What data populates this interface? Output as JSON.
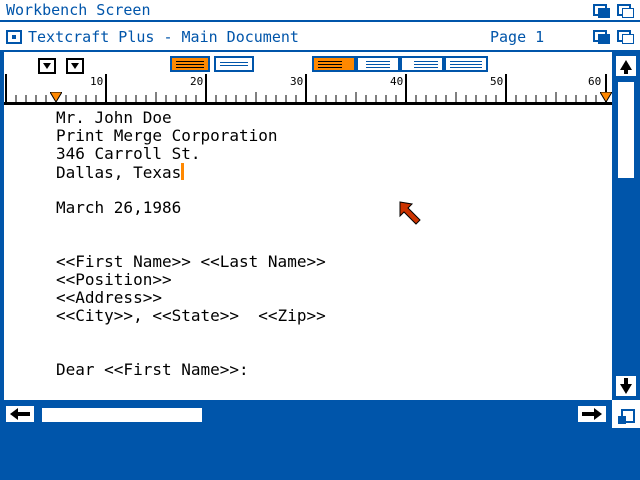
{
  "screen": {
    "title": "Workbench Screen"
  },
  "window": {
    "title": "Textcraft Plus - Main Document",
    "page_label": "Page 1"
  },
  "ruler": {
    "ticks": [
      "10",
      "20",
      "30",
      "40",
      "50",
      "60"
    ]
  },
  "document": {
    "lines": [
      "Mr. John Doe",
      "Print Merge Corporation",
      "346 Carroll St.",
      "Dallas, Texas",
      "",
      "March 26,1986",
      "",
      "",
      "<<First Name>> <<Last Name>>",
      "<<Position>>",
      "<<Address>>",
      "<<City>>, <<State>>  <<Zip>>",
      "",
      "",
      "Dear <<First Name>>:"
    ]
  },
  "colors": {
    "workbench_blue": "#0055aa",
    "highlight_orange": "#ff8800",
    "background_white": "#ffffff"
  },
  "icons": {
    "close": "close-gadget-icon",
    "depth": "depth-gadget-icon",
    "scroll_up": "arrow-up-icon",
    "scroll_down": "arrow-down-icon",
    "scroll_left": "arrow-left-icon",
    "scroll_right": "arrow-right-icon",
    "pointer": "mouse-pointer-icon"
  }
}
